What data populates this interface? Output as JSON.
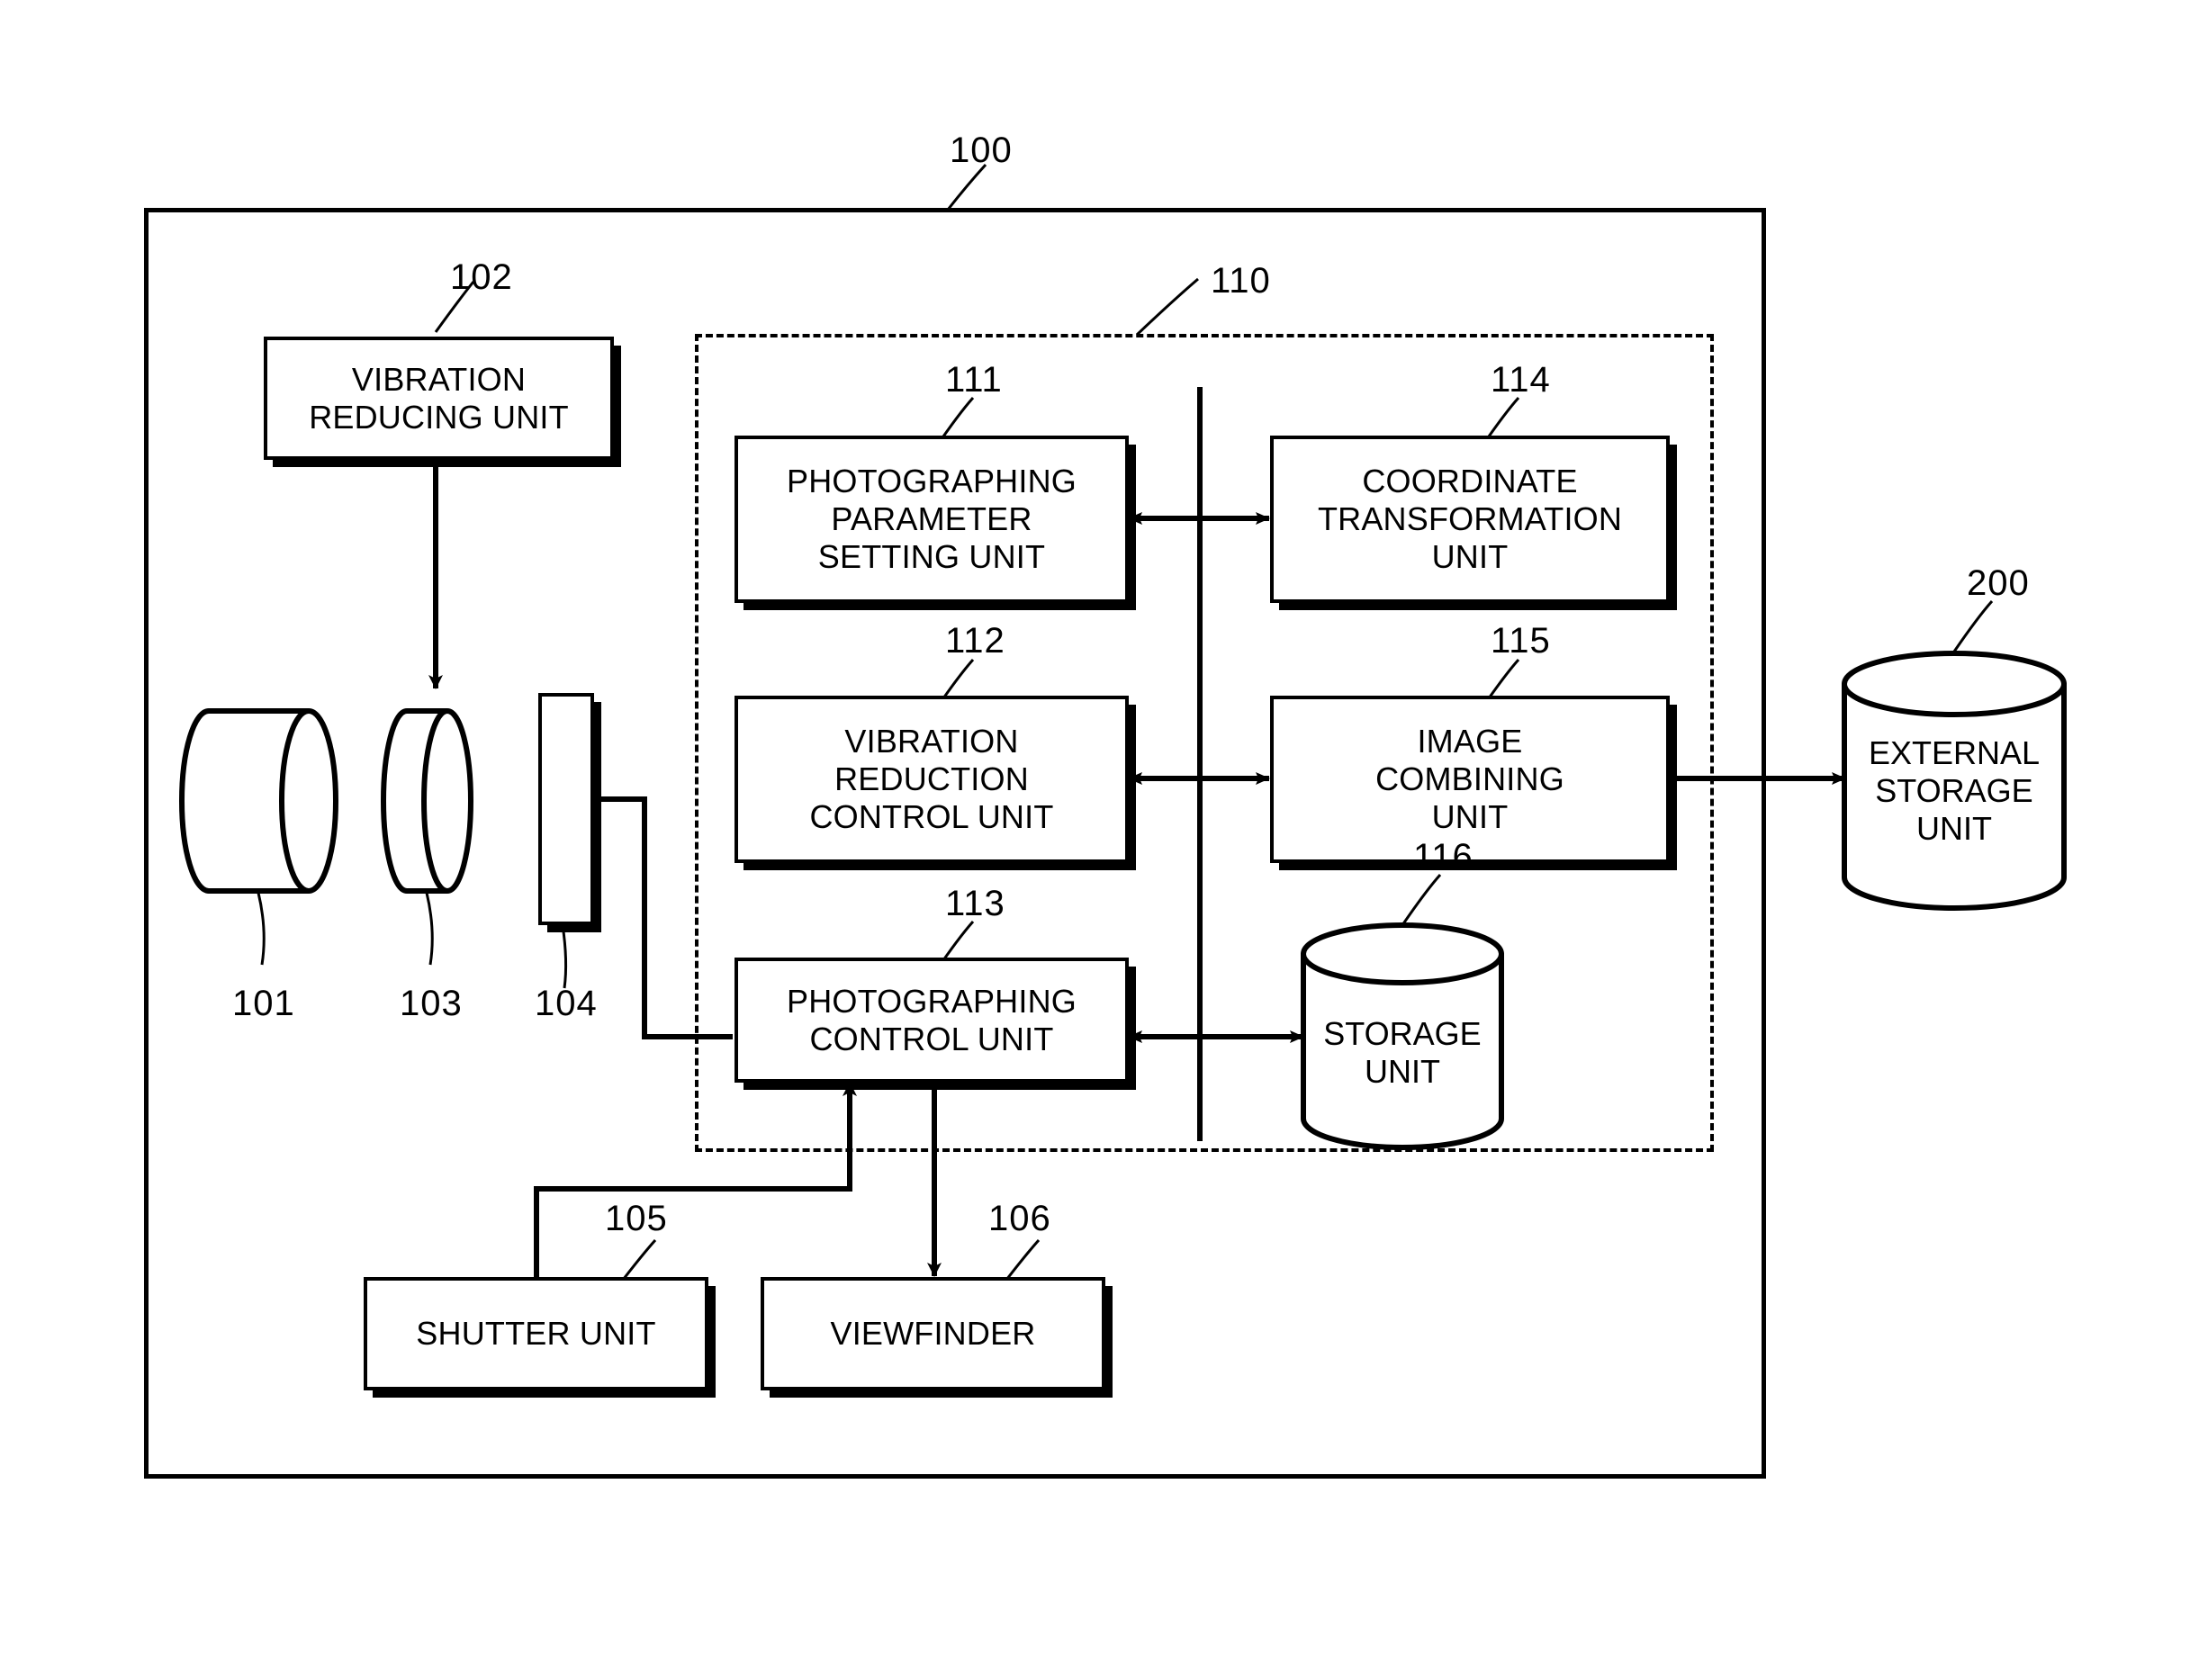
{
  "figure": {
    "outer_frame_ref": "100",
    "dashed_frame_ref": "110"
  },
  "blocks": [
    {
      "id": "102",
      "label": "VIBRATION\nREDUCING UNIT",
      "ref": "102"
    },
    {
      "id": "111",
      "label": "PHOTOGRAPHING\nPARAMETER\nSETTING UNIT",
      "ref": "111"
    },
    {
      "id": "114",
      "label": "COORDINATE\nTRANSFORMATION\nUNIT",
      "ref": "114"
    },
    {
      "id": "112",
      "label": "VIBRATION\nREDUCTION\nCONTROL UNIT",
      "ref": "112"
    },
    {
      "id": "115",
      "label": "IMAGE\nCOMBINING\nUNIT",
      "ref": "115"
    },
    {
      "id": "113",
      "label": "PHOTOGRAPHING\nCONTROL UNIT",
      "ref": "113"
    },
    {
      "id": "105",
      "label": "SHUTTER UNIT",
      "ref": "105"
    },
    {
      "id": "106",
      "label": "VIEWFINDER",
      "ref": "106"
    }
  ],
  "cylinders": [
    {
      "id": "101",
      "label": "",
      "ref": "101"
    },
    {
      "id": "103",
      "label": "",
      "ref": "103"
    },
    {
      "id": "116",
      "label": "STORAGE\nUNIT",
      "ref": "116"
    },
    {
      "id": "200",
      "label": "EXTERNAL\nSTORAGE\nUNIT",
      "ref": "200"
    }
  ],
  "rects": [
    {
      "id": "104",
      "label": "",
      "ref": "104"
    }
  ],
  "refs": {
    "r100": "100",
    "r101": "101",
    "r102": "102",
    "r103": "103",
    "r104": "104",
    "r105": "105",
    "r106": "106",
    "r110": "110",
    "r111": "111",
    "r112": "112",
    "r113": "113",
    "r114": "114",
    "r115": "115",
    "r116": "116",
    "r200": "200"
  },
  "labels": {
    "vibration_reducing_unit_l1": "VIBRATION",
    "vibration_reducing_unit_l2": "REDUCING UNIT",
    "photographing_parameter_setting_unit_l1": "PHOTOGRAPHING",
    "photographing_parameter_setting_unit_l2": "PARAMETER",
    "photographing_parameter_setting_unit_l3": "SETTING UNIT",
    "coordinate_transformation_unit_l1": "COORDINATE",
    "coordinate_transformation_unit_l2": "TRANSFORMATION",
    "coordinate_transformation_unit_l3": "UNIT",
    "vibration_reduction_control_unit_l1": "VIBRATION",
    "vibration_reduction_control_unit_l2": "REDUCTION",
    "vibration_reduction_control_unit_l3": "CONTROL UNIT",
    "image_combining_unit_l1": "IMAGE",
    "image_combining_unit_l2": "COMBINING",
    "image_combining_unit_l3": "UNIT",
    "photographing_control_unit_l1": "PHOTOGRAPHING",
    "photographing_control_unit_l2": "CONTROL UNIT",
    "storage_unit_l1": "STORAGE",
    "storage_unit_l2": "UNIT",
    "external_storage_unit_l1": "EXTERNAL",
    "external_storage_unit_l2": "STORAGE",
    "external_storage_unit_l3": "UNIT",
    "shutter_unit": "SHUTTER UNIT",
    "viewfinder": "VIEWFINDER"
  },
  "colors": {
    "stroke": "#000000",
    "background": "#ffffff"
  }
}
